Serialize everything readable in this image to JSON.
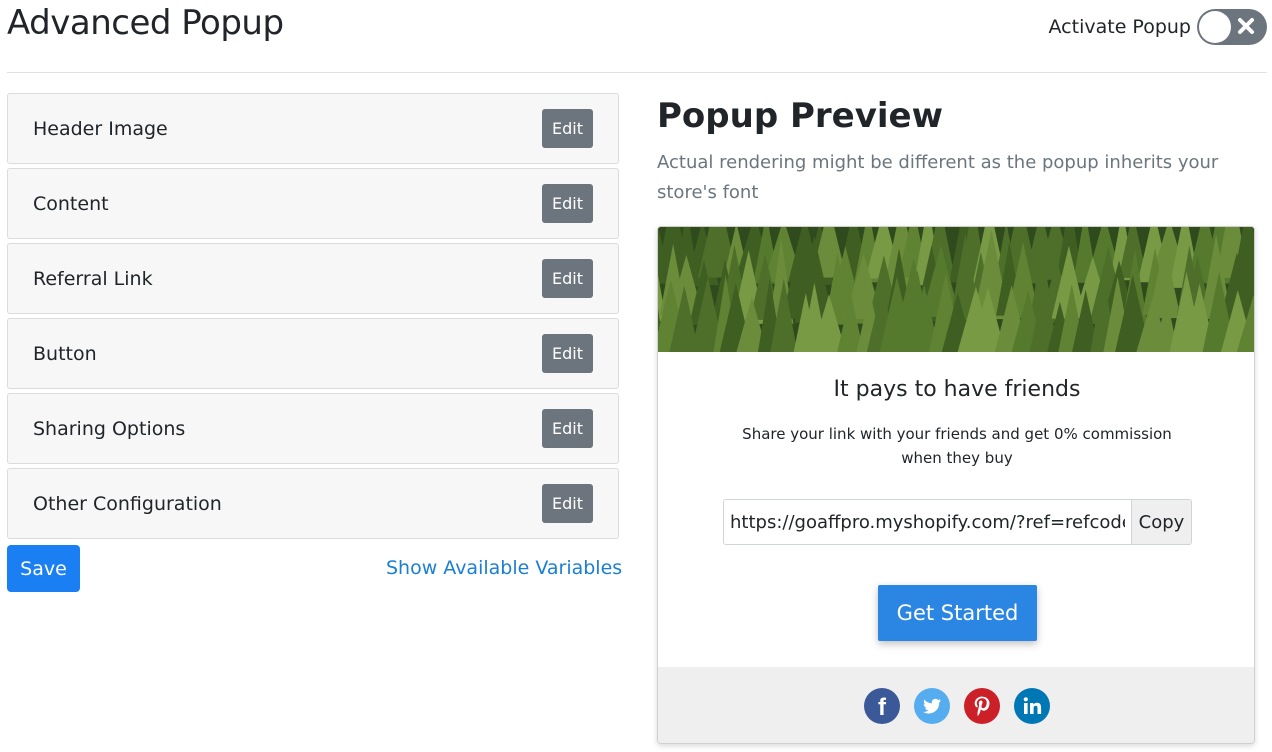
{
  "page": {
    "title": "Advanced Popup"
  },
  "activate": {
    "label": "Activate Popup",
    "enabled": false
  },
  "sections": [
    {
      "label": "Header Image",
      "action": "Edit"
    },
    {
      "label": "Content",
      "action": "Edit"
    },
    {
      "label": "Referral Link",
      "action": "Edit"
    },
    {
      "label": "Button",
      "action": "Edit"
    },
    {
      "label": "Sharing Options",
      "action": "Edit"
    },
    {
      "label": "Other Configuration",
      "action": "Edit"
    }
  ],
  "actions": {
    "save": "Save",
    "variables": "Show Available Variables"
  },
  "preview": {
    "title": "Popup Preview",
    "note": "Actual rendering might be different as the popup inherits your store's font",
    "heading": "It pays to have friends",
    "text": "Share your link with your friends and get 0% commission when they buy",
    "link_value": "https://goaffpro.myshopify.com/?ref=refcode",
    "copy": "Copy",
    "cta": "Get Started"
  },
  "share_icons": [
    {
      "name": "facebook-icon",
      "color": "#3b5998"
    },
    {
      "name": "twitter-icon",
      "color": "#55acee"
    },
    {
      "name": "pinterest-icon",
      "color": "#cb2027"
    },
    {
      "name": "linkedin-icon",
      "color": "#0077b5"
    }
  ],
  "colors": {
    "primary": "#1a7ff2",
    "secondary": "#6c757d",
    "link": "#1a7fd4"
  }
}
